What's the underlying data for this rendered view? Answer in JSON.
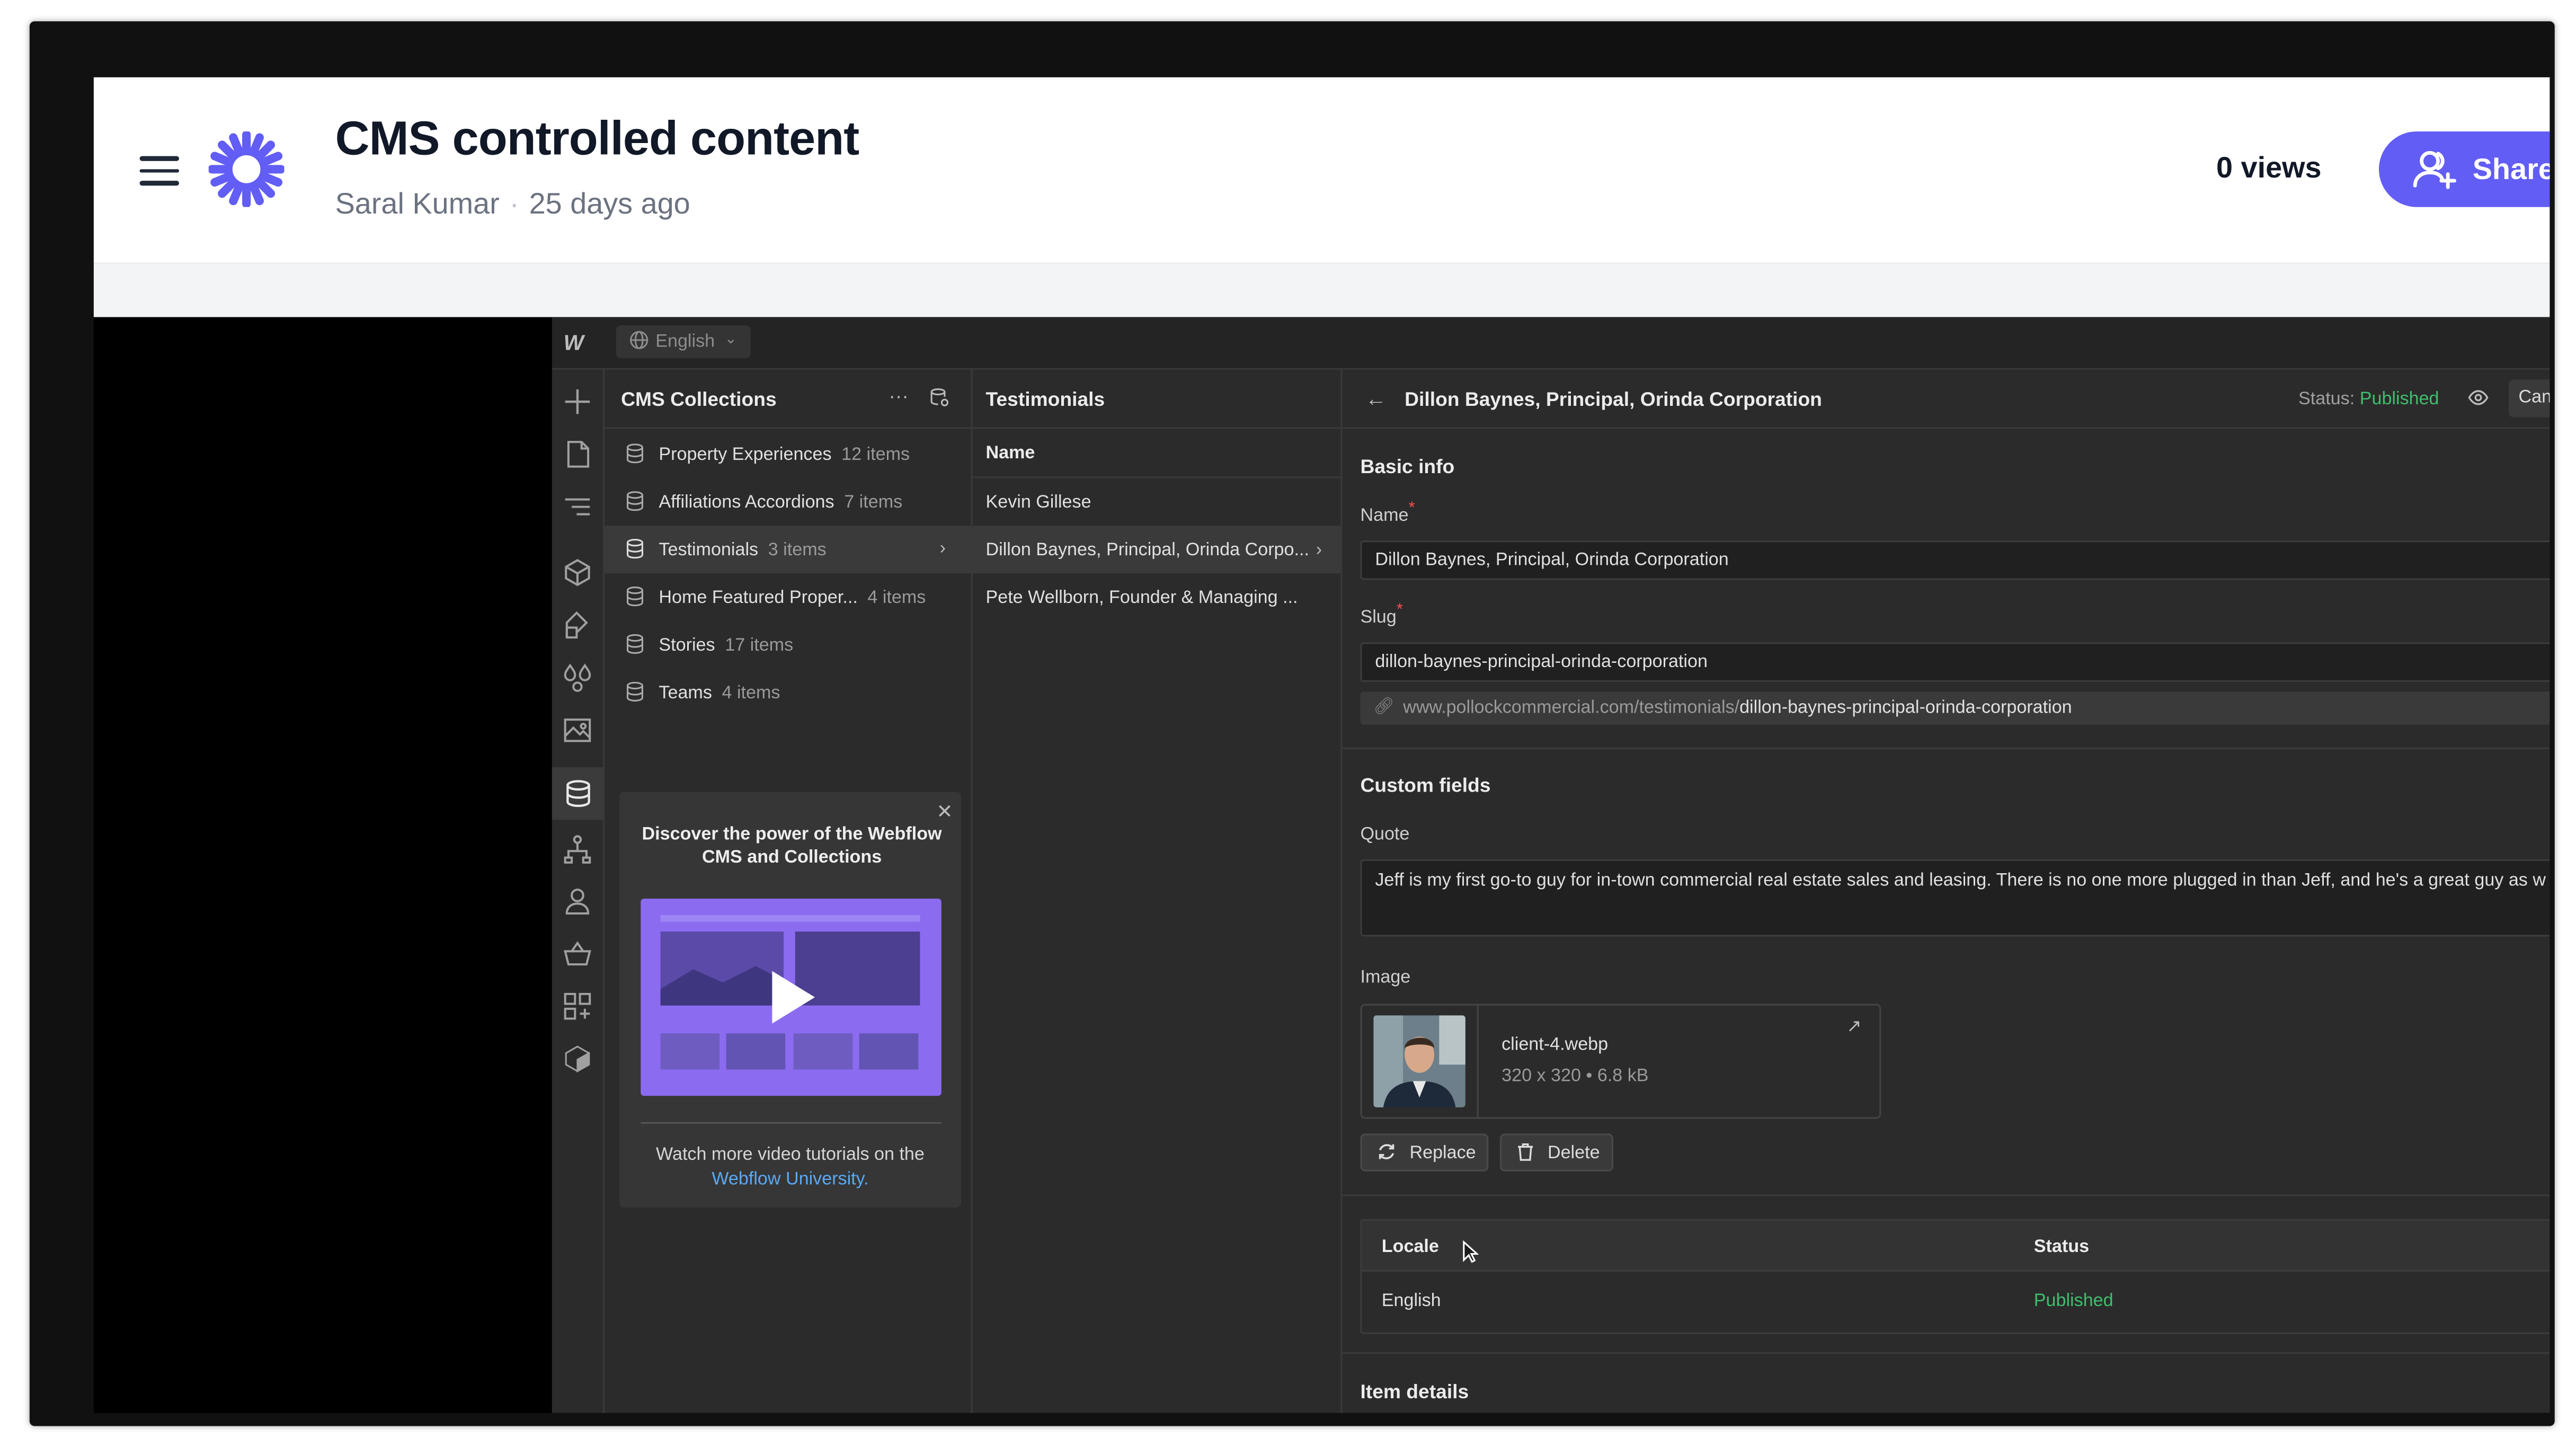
{
  "header": {
    "title": "CMS controlled content",
    "author": "Saral Kumar",
    "separator": "·",
    "time_ago": "25 days ago",
    "views": "0 views",
    "share_label": "Share",
    "accent_color": "#625df5"
  },
  "app": {
    "logo": "W",
    "language": "English",
    "sidebar_icons": [
      "plus-icon",
      "page-icon",
      "navigator-icon",
      "components-icon",
      "style-manager-icon",
      "variables-icon",
      "assets-icon",
      "cms-icon",
      "logic-icon",
      "users-icon",
      "ecommerce-icon",
      "apps-icon",
      "libraries-icon"
    ],
    "collections": {
      "title": "CMS Collections",
      "items": [
        {
          "name": "Property Experiences",
          "count": "12 items"
        },
        {
          "name": "Affiliations Accordions",
          "count": "7 items"
        },
        {
          "name": "Testimonials",
          "count": "3 items"
        },
        {
          "name": "Home Featured Proper...",
          "count": "4 items"
        },
        {
          "name": "Stories",
          "count": "17 items"
        },
        {
          "name": "Teams",
          "count": "4 items"
        }
      ],
      "promo": {
        "title": "Discover the power of the Webflow CMS and Collections",
        "footer": "Watch more video tutorials on the",
        "link": "Webflow University."
      }
    },
    "list": {
      "title": "Testimonials",
      "column": "Name",
      "rows": [
        "Kevin Gillese",
        "Dillon Baynes, Principal, Orinda Corpo...",
        "Pete Wellborn, Founder & Managing ..."
      ]
    },
    "item": {
      "title": "Dillon Baynes, Principal, Orinda Corporation",
      "status_label": "Status:",
      "status_value": "Published",
      "cancel": "Can",
      "basic_info": "Basic info",
      "name_label": "Name",
      "required_mark": "*",
      "name_value": "Dillon Baynes, Principal, Orinda Corporation",
      "slug_label": "Slug",
      "slug_value": "dillon-baynes-principal-orinda-corporation",
      "url_base": "www.pollockcommercial.com/testimonials/",
      "url_slug": "dillon-baynes-principal-orinda-corporation",
      "custom_fields": "Custom fields",
      "quote_label": "Quote",
      "quote_value": "Jeff is my first go-to guy for in-town commercial real estate sales and leasing. There is no one more plugged in than Jeff, and he's a great guy as w",
      "image_label": "Image",
      "image_filename": "client-4.webp",
      "image_meta": "320 x 320 • 6.8 kB",
      "replace": "Replace",
      "delete": "Delete",
      "locale_header": "Locale",
      "status_header": "Status",
      "locale_value": "English",
      "locale_status": "Published",
      "item_details": "Item details"
    },
    "published_color": "#3fbf6e"
  }
}
